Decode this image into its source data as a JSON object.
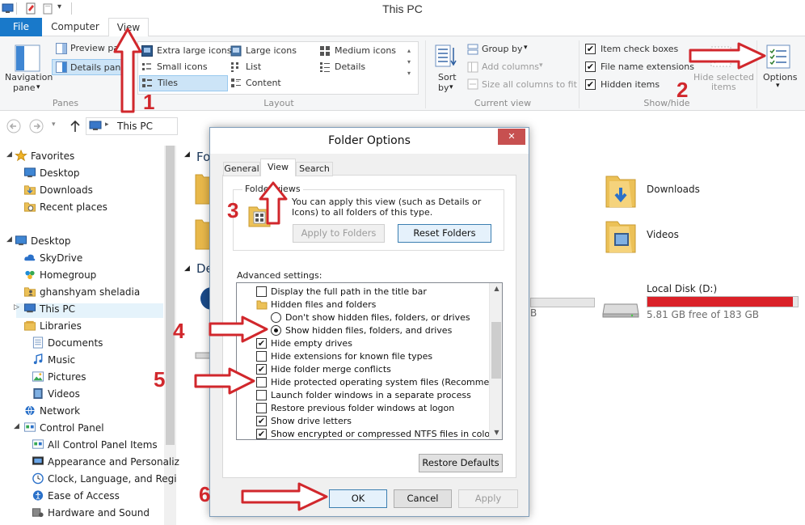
{
  "window": {
    "title": "This PC"
  },
  "tabs": {
    "file": "File",
    "computer": "Computer",
    "view": "View"
  },
  "ribbon": {
    "navigation_pane": "Navigation",
    "navigation_pane2": "pane",
    "preview_pane": "Preview pane",
    "details_pane": "Details pane",
    "panes_group": "Panes",
    "layout": [
      "Extra large icons",
      "Large icons",
      "Medium icons",
      "Small icons",
      "List",
      "Details",
      "Tiles",
      "Content"
    ],
    "layout_group": "Layout",
    "sort_by": "Sort",
    "sort_by2": "by",
    "group_by": "Group by",
    "add_columns": "Add columns",
    "size_columns": "Size all columns to fit",
    "current_view_group": "Current view",
    "item_check_boxes": "Item check boxes",
    "file_name_extensions": "File name extensions",
    "hidden_items": "Hidden items",
    "hide_selected": "Hide selected",
    "hide_selected2": "items",
    "show_hide_group": "Show/hide",
    "options": "Options"
  },
  "address": {
    "path": "This PC"
  },
  "sidebar": {
    "items": [
      "Favorites",
      "Desktop",
      "Downloads",
      "Recent places",
      "Desktop",
      "SkyDrive",
      "Homegroup",
      "ghanshyam sheladia",
      "This PC",
      "Libraries",
      "Documents",
      "Music",
      "Pictures",
      "Videos",
      "Network",
      "Control Panel",
      "All Control Panel Items",
      "Appearance and Personaliz",
      "Clock, Language, and Regi",
      "Ease of Access",
      "Hardware and Sound"
    ]
  },
  "content": {
    "section_folders": "Fo",
    "section_devices": "De",
    "folder_downloads": "Downloads",
    "folder_videos": "Videos",
    "disk_name": "Local Disk (D:)",
    "disk_free": "5.81 GB free of 183 GB",
    "partial_value": "B",
    "disk_fill_pct": 97
  },
  "dialog": {
    "title": "Folder Options",
    "close": "✕",
    "tabs": [
      "General",
      "View",
      "Search"
    ],
    "folder_views_legend": "Folder views",
    "folder_views_text": "You can apply this view (such as Details or Icons) to all folders of this type.",
    "apply_to_folders": "Apply to Folders",
    "reset_folders": "Reset Folders",
    "advanced_label": "Advanced settings:",
    "settings": [
      {
        "label": "Display the full path in the title bar",
        "type": "checkbox",
        "checked": false
      },
      {
        "label": "Hidden files and folders",
        "type": "folder",
        "checked": false
      },
      {
        "label": "Don't show hidden files, folders, or drives",
        "type": "radio",
        "checked": false
      },
      {
        "label": "Show hidden files, folders, and drives",
        "type": "radio",
        "checked": true
      },
      {
        "label": "Hide empty drives",
        "type": "checkbox",
        "checked": true
      },
      {
        "label": "Hide extensions for known file types",
        "type": "checkbox",
        "checked": false
      },
      {
        "label": "Hide folder merge conflicts",
        "type": "checkbox",
        "checked": true
      },
      {
        "label": "Hide protected operating system files (Recommended)",
        "type": "checkbox",
        "checked": false
      },
      {
        "label": "Launch folder windows in a separate process",
        "type": "checkbox",
        "checked": false
      },
      {
        "label": "Restore previous folder windows at logon",
        "type": "checkbox",
        "checked": false
      },
      {
        "label": "Show drive letters",
        "type": "checkbox",
        "checked": true
      },
      {
        "label": "Show encrypted or compressed NTFS files in color",
        "type": "checkbox",
        "checked": true
      }
    ],
    "restore_defaults": "Restore Defaults",
    "ok": "OK",
    "cancel": "Cancel",
    "apply": "Apply"
  },
  "annotations": {
    "step1": "1",
    "step2": "2",
    "step3": "3",
    "step4": "4",
    "step5": "5",
    "step6": "6"
  },
  "colors": {
    "accent": "#1979ca",
    "annotation": "#d1272c",
    "disk_bar": "#da2128"
  }
}
